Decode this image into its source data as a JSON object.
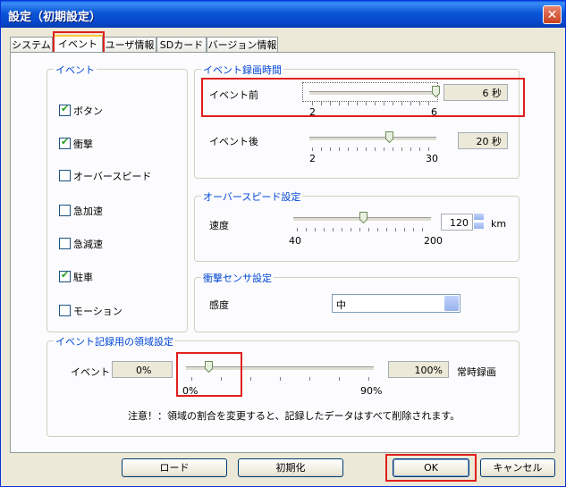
{
  "window": {
    "title": "設定（初期設定）",
    "close_glyph": "✕"
  },
  "tabs": [
    "システム",
    "イベント",
    "ユーザ情報",
    "SDカード",
    "バージョン情報"
  ],
  "event_group": {
    "title": "イベント",
    "items": [
      {
        "label": "ボタン",
        "checked": true
      },
      {
        "label": "衝撃",
        "checked": true
      },
      {
        "label": "オーバースピード",
        "checked": false
      },
      {
        "label": "急加速",
        "checked": false
      },
      {
        "label": "急減速",
        "checked": false
      },
      {
        "label": "駐車",
        "checked": true
      },
      {
        "label": "モーション",
        "checked": false
      }
    ]
  },
  "event_time": {
    "title": "イベント録画時間",
    "before": {
      "label": "イベント前",
      "value": "6 秒",
      "min": "2",
      "max": "6",
      "level": 6
    },
    "after": {
      "label": "イベント後",
      "value": "20 秒",
      "min": "2",
      "max": "30",
      "level": 20
    }
  },
  "overspeed": {
    "title": "オーバースピード設定",
    "label": "速度",
    "value": "120",
    "unit": "km",
    "min": "40",
    "max": "200",
    "level": 120
  },
  "shock": {
    "title": "衝撃センサ設定",
    "label": "感度",
    "value": "中"
  },
  "region": {
    "title": "イベント記録用の領域設定",
    "event_label": "イベント",
    "event_value": "0%",
    "always_value": "100%",
    "always_label": "常時録画",
    "min": "0%",
    "max": "90%",
    "level_percent": 10,
    "note": "注意！：領域の割合を変更すると、記録したデータはすべて削除されます。"
  },
  "buttons": {
    "load": "ロード",
    "init": "初期化",
    "ok": "OK",
    "cancel": "キャンセル"
  }
}
